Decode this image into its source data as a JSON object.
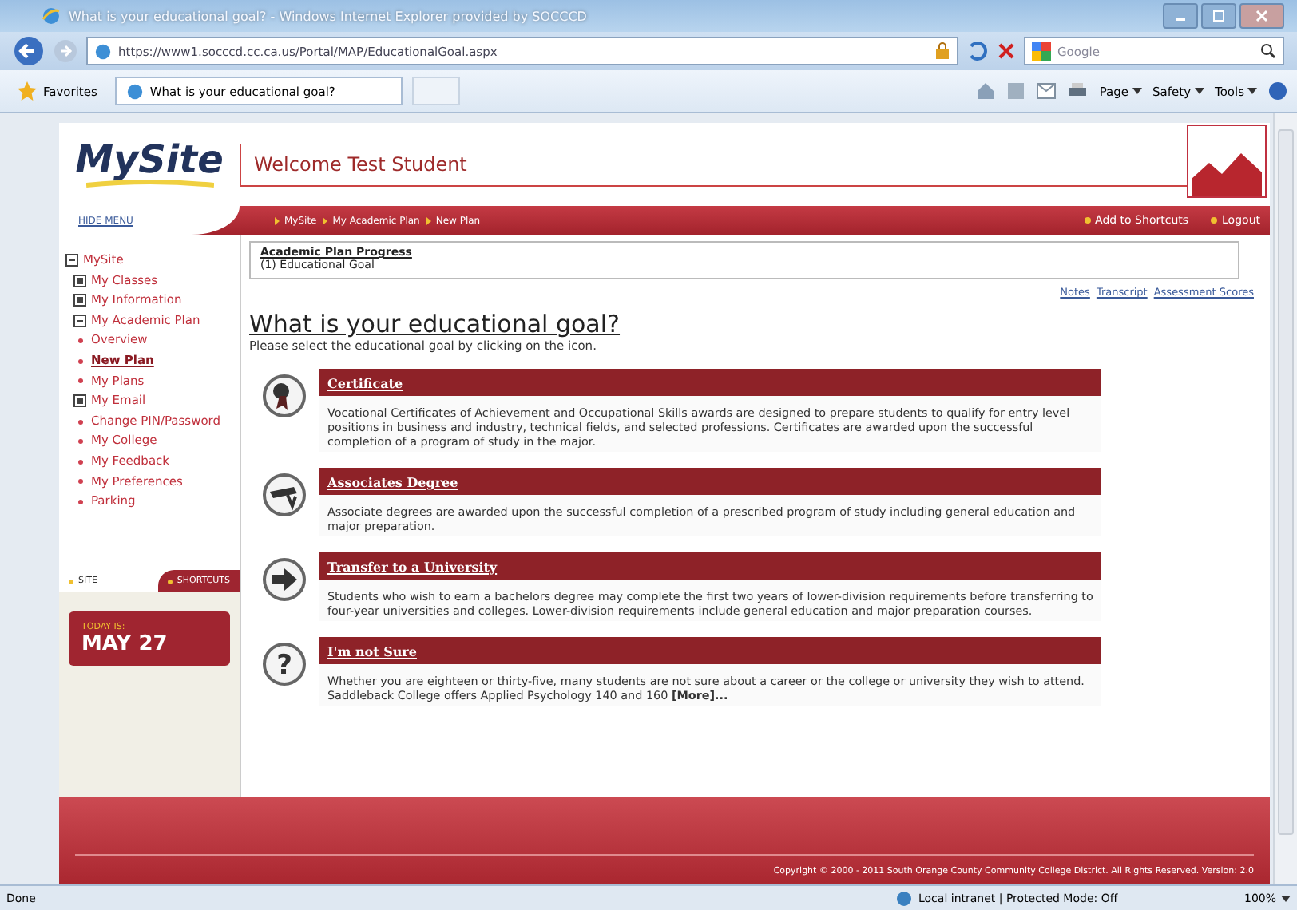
{
  "window": {
    "title": "What is your educational goal? - Windows Internet Explorer provided by SOCCCD"
  },
  "address_bar": {
    "url": "https://www1.socccd.cc.ca.us/Portal/MAP/EducationalGoal.aspx",
    "search_placeholder": "Google"
  },
  "favorites_bar": {
    "favorites": "Favorites",
    "tab": "What is your educational goal?",
    "commands": [
      "Page",
      "Safety",
      "Tools"
    ]
  },
  "header": {
    "logo": "MySite",
    "welcome": "Welcome Test Student",
    "hide_menu": "HIDE MENU",
    "breadcrumb": [
      "MySite",
      "My Academic Plan",
      "New Plan"
    ],
    "actions": [
      "Add to Shortcuts",
      "Logout"
    ]
  },
  "sidebar": {
    "items": [
      {
        "label": "MySite",
        "kind": "folder",
        "expanded": true,
        "selected": false,
        "children": [
          {
            "label": "My Classes",
            "kind": "folder",
            "expanded": false,
            "selected": false
          },
          {
            "label": "My Information",
            "kind": "folder",
            "expanded": false,
            "selected": false
          },
          {
            "label": "My Academic Plan",
            "kind": "folder",
            "expanded": true,
            "selected": false,
            "children": [
              {
                "label": "Overview",
                "kind": "link",
                "selected": false
              },
              {
                "label": "New Plan",
                "kind": "link",
                "selected": true
              },
              {
                "label": "My Plans",
                "kind": "link",
                "selected": false
              }
            ]
          },
          {
            "label": "My Email",
            "kind": "folder",
            "expanded": false,
            "selected": false
          },
          {
            "label": "Change PIN/Password",
            "kind": "link",
            "selected": false
          },
          {
            "label": "My College",
            "kind": "link",
            "selected": false
          },
          {
            "label": "My Feedback",
            "kind": "link",
            "selected": false
          },
          {
            "label": "My Preferences",
            "kind": "link",
            "selected": false
          },
          {
            "label": "Parking",
            "kind": "link",
            "selected": false
          }
        ]
      }
    ],
    "tabs": [
      {
        "label": "SITE",
        "selected": true
      },
      {
        "label": "SHORTCUTS",
        "selected": false
      }
    ],
    "date_label": "TODAY IS:",
    "date": "MAY 27"
  },
  "progress": {
    "title": "Academic Plan Progress",
    "step": "(1) Educational Goal"
  },
  "links": [
    "Notes",
    "Transcript",
    "Assessment Scores"
  ],
  "heading": "What is your educational goal?",
  "subtitle": "Please select the educational goal by clicking on the icon.",
  "goals": [
    {
      "kind": "certificate",
      "title": "Certificate",
      "description": "Vocational Certificates of Achievement and Occupational Skills awards are designed to prepare students to qualify for entry level positions in business and industry, technical fields, and selected professions. Certificates are awarded upon the successful completion of a program of study in the major."
    },
    {
      "kind": "degree",
      "title": "Associates Degree",
      "description": "Associate degrees are awarded upon the successful completion of a prescribed program of study including general education and major preparation."
    },
    {
      "kind": "transfer",
      "title": "Transfer to a University",
      "description": "Students who wish to earn a bachelors degree may complete the first two years of lower-division requirements before transferring to four-year universities and colleges. Lower-division requirements include general education and major preparation courses."
    },
    {
      "kind": "unsure",
      "symbol": "?",
      "title": "I'm not Sure",
      "description": "Whether you are eighteen or thirty-five, many students are not sure about a career or the college or university they wish to attend. Saddleback College offers Applied Psychology 140 and 160 **[More]...**"
    }
  ],
  "footer": "Copyright © 2000 - 2011 South Orange County Community College District. All Rights Reserved. Version: 2.0",
  "status_bar": {
    "status": "Done",
    "zone": "Local intranet | Protected Mode: Off",
    "zoom": "100%"
  }
}
